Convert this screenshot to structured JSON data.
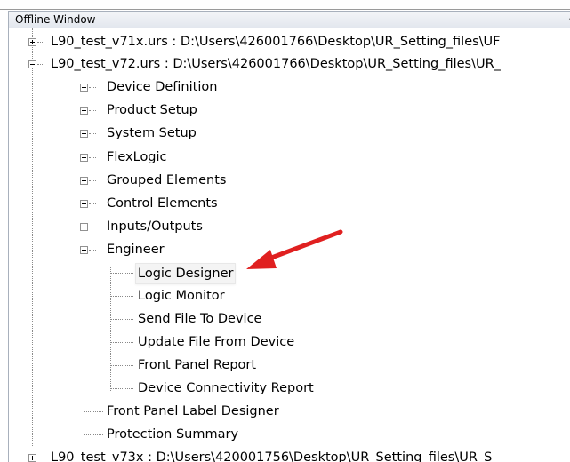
{
  "window": {
    "title": "Offline Window"
  },
  "tree": {
    "files": [
      {
        "label": "L90_test_v71x.urs : D:\\Users\\426001766\\Desktop\\UR_Setting_files\\UF"
      },
      {
        "label": "L90_test_v72.urs : D:\\Users\\426001766\\Desktop\\UR_Setting_files\\UR_"
      },
      {
        "label": "L90_test_v73x : D:\\Users\\420001756\\Desktop\\UR_Setting_files\\UR_S"
      }
    ],
    "sections": [
      {
        "label": "Device Definition"
      },
      {
        "label": "Product Setup"
      },
      {
        "label": "System Setup"
      },
      {
        "label": "FlexLogic"
      },
      {
        "label": "Grouped Elements"
      },
      {
        "label": "Control Elements"
      },
      {
        "label": "Inputs/Outputs"
      },
      {
        "label": "Engineer"
      }
    ],
    "engineer_items": [
      {
        "label": "Logic Designer"
      },
      {
        "label": "Logic Monitor"
      },
      {
        "label": "Send File To Device"
      },
      {
        "label": "Update File From Device"
      },
      {
        "label": "Front Panel Report"
      },
      {
        "label": "Device Connectivity Report"
      }
    ],
    "leaf_items": [
      {
        "label": "Front Panel Label Designer"
      },
      {
        "label": "Protection Summary"
      }
    ]
  },
  "colors": {
    "arrow": "#e02020",
    "tree_lines": "#8a8a8a"
  },
  "icons": {
    "expand": "plus-box-icon",
    "collapse": "minus-box-icon",
    "annotation": "red-arrow-icon"
  }
}
